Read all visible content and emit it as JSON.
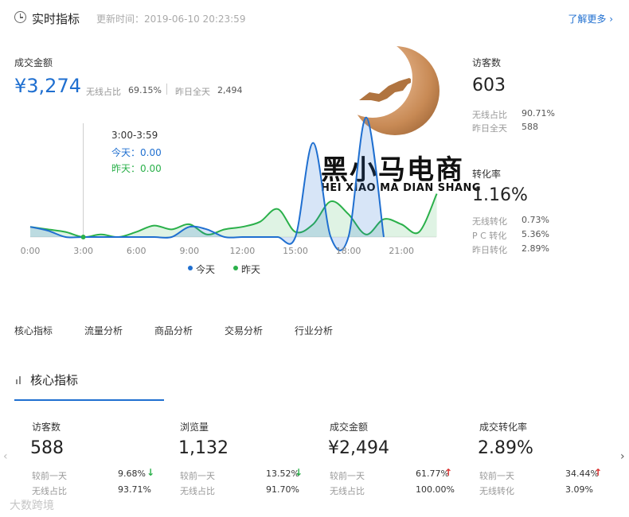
{
  "header": {
    "title": "实时指标",
    "update_time": "更新时间：2019-06-10 20:23:59",
    "learn_more": "了解更多"
  },
  "left_metric": {
    "label": "成交金额",
    "value": "¥3,274",
    "wireless_label": "无线占比",
    "wireless_value": "69.15%",
    "yesterday_label": "昨日全天",
    "yesterday_value": "2,494"
  },
  "tooltip": {
    "time": "3:00-3:59",
    "today": "今天：0.00",
    "yesterday": "昨天：0.00"
  },
  "legend": {
    "today": "今天",
    "yesterday": "昨天"
  },
  "chart_data": {
    "type": "area",
    "categories": [
      "0:00",
      "1:00",
      "2:00",
      "3:00",
      "4:00",
      "5:00",
      "6:00",
      "7:00",
      "8:00",
      "9:00",
      "10:00",
      "11:00",
      "12:00",
      "13:00",
      "14:00",
      "15:00",
      "16:00",
      "17:00",
      "18:00",
      "19:00",
      "20:00",
      "21:00",
      "22:00",
      "23:00"
    ],
    "x_tick_labels": [
      "0:00",
      "3:00",
      "6:00",
      "9:00",
      "12:00",
      "15:00",
      "18:00",
      "21:00"
    ],
    "series": [
      {
        "name": "今天",
        "color": "#1f6fd0",
        "values": [
          80,
          50,
          0,
          0,
          0,
          0,
          0,
          0,
          0,
          80,
          60,
          0,
          0,
          0,
          0,
          0,
          740,
          0,
          0,
          940,
          0
        ]
      },
      {
        "name": "昨天",
        "color": "#2ab04a",
        "values": [
          80,
          60,
          40,
          0,
          20,
          0,
          40,
          90,
          60,
          100,
          20,
          60,
          80,
          120,
          220,
          40,
          100,
          280,
          180,
          20,
          140,
          100,
          40,
          340
        ]
      }
    ]
  },
  "right_metrics": {
    "visitors": {
      "label": "访客数",
      "value": "603",
      "wireless_label": "无线占比",
      "wireless_value": "90.71%",
      "yesterday_label": "昨日全天",
      "yesterday_value": "588"
    },
    "conversion": {
      "label": "转化率",
      "value": "1.16%",
      "rows": [
        {
          "label": "无线转化",
          "value": "0.73%"
        },
        {
          "label": "P C 转化",
          "value": "5.36%"
        },
        {
          "label": "昨日转化",
          "value": "2.89%"
        }
      ]
    }
  },
  "logo": {
    "cn": "黑小马电商",
    "en": "HEI XIAO MA DIAN SHANG"
  },
  "tabs": [
    "核心指标",
    "流量分析",
    "商品分析",
    "交易分析",
    "行业分析"
  ],
  "section": {
    "title": "核心指标"
  },
  "cards": [
    {
      "label": "访客数",
      "value": "588",
      "cmp_label": "较前一天",
      "cmp_value": "9.68%",
      "dir": "down",
      "sub_label": "无线占比",
      "sub_value": "93.71%"
    },
    {
      "label": "浏览量",
      "value": "1,132",
      "cmp_label": "较前一天",
      "cmp_value": "13.52%",
      "dir": "down",
      "sub_label": "无线占比",
      "sub_value": "91.70%"
    },
    {
      "label": "成交金额",
      "value": "¥2,494",
      "cmp_label": "较前一天",
      "cmp_value": "61.77%",
      "dir": "up",
      "sub_label": "无线占比",
      "sub_value": "100.00%"
    },
    {
      "label": "成交转化率",
      "value": "2.89%",
      "cmp_label": "较前一天",
      "cmp_value": "34.44%",
      "dir": "up",
      "sub_label": "无线转化",
      "sub_value": "3.09%"
    }
  ],
  "arrows": {
    "up": "↑",
    "down": "↓",
    "left": "‹",
    "right": "›"
  },
  "watermark": "大数跨境"
}
